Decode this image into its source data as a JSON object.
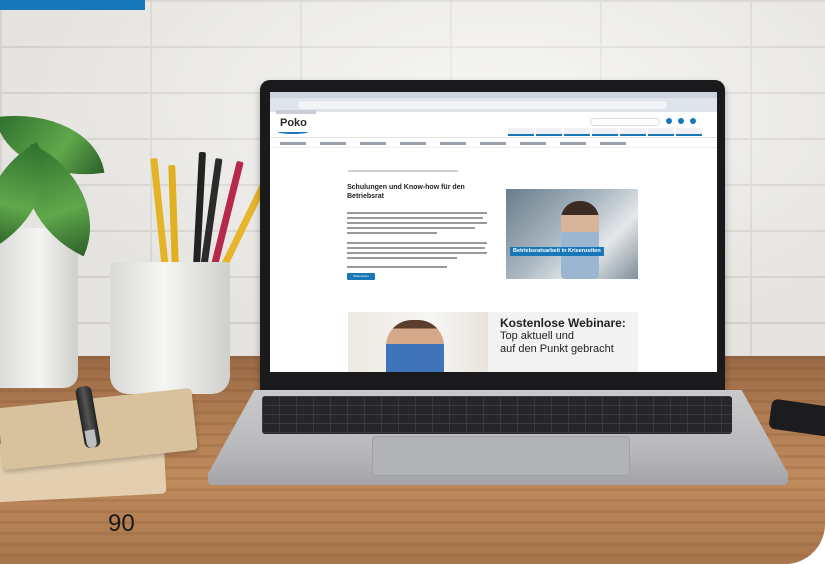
{
  "page": {
    "number": "90"
  },
  "accent_color": "#1777b8",
  "screen": {
    "site": {
      "logo": "Poko",
      "headline": "Schulungen und Know-how für den Betriebsrat",
      "cta_label": "Weiterlesen",
      "hero_caption": "Betriebsratsarbeit in Krisenzeiten",
      "banner": {
        "title": "Kostenlose Webinare:",
        "subtitle_line1": "Top aktuell und",
        "subtitle_line2": "auf den Punkt gebracht"
      }
    }
  }
}
